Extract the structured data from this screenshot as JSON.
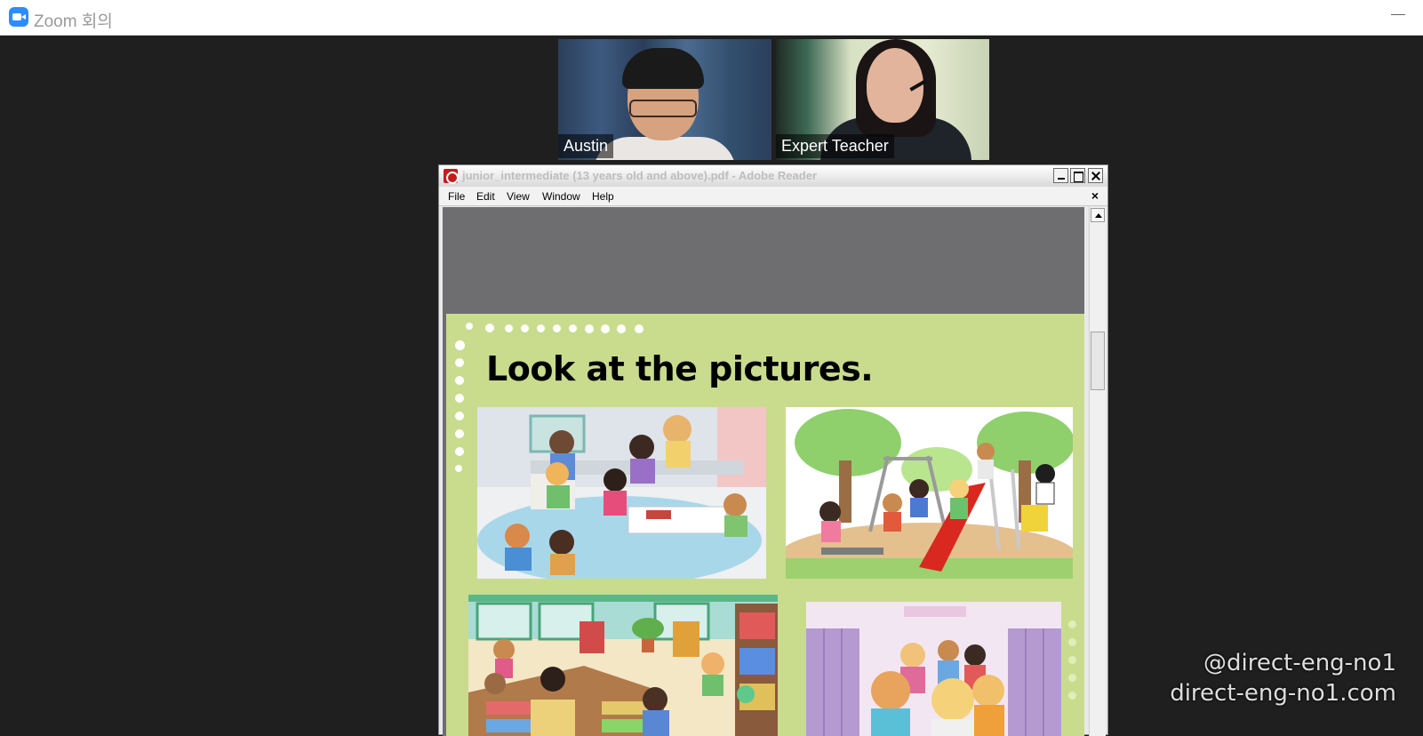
{
  "zoom": {
    "title": "Zoom 회의",
    "participants": [
      {
        "name": "Austin"
      },
      {
        "name": "Expert Teacher"
      }
    ]
  },
  "reader": {
    "title": "junior_intermediate (13 years old and above).pdf - Adobe Reader",
    "menu": [
      "File",
      "Edit",
      "View",
      "Window",
      "Help"
    ],
    "page_heading": "Look at the pictures."
  },
  "watermark": {
    "handle": "@direct-eng-no1",
    "site": "direct-eng-no1.com"
  },
  "colors": {
    "page_background": "#c9dc8e",
    "viewport_gray": "#6e6e70",
    "zoom_blue": "#2d8cff"
  }
}
